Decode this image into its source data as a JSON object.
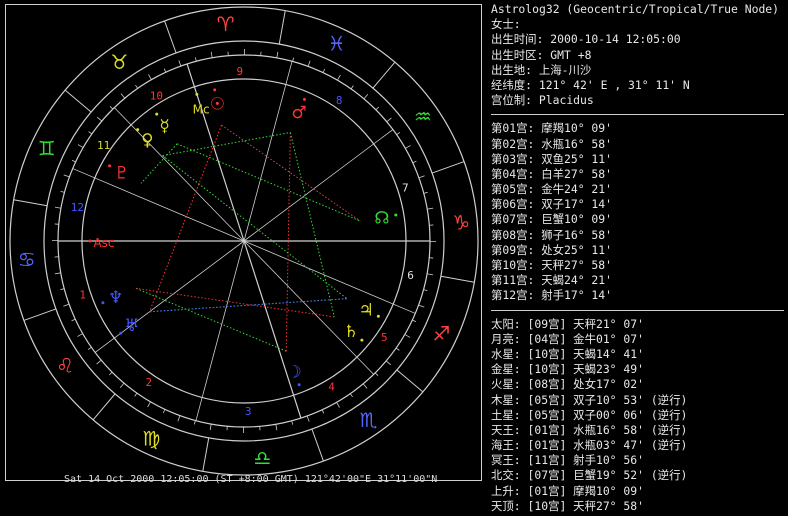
{
  "header": {
    "title": "Astrolog32 (Geocentric/Tropical/True Node)",
    "name_label": "女士:",
    "birth_time": "出生时间: 2000-10-14 12:05:00",
    "birth_zone": "出生时区: GMT +8",
    "birth_place": "出生地: 上海-川沙",
    "coordinates": "经纬度: 121° 42' E , 31° 11' N",
    "house_system": "宫位制: Placidus"
  },
  "houses": [
    "第01宫: 摩羯10° 09'",
    "第02宫: 水瓶16° 58'",
    "第03宫: 双鱼25° 11'",
    "第04宫: 白羊27° 58'",
    "第05宫: 金牛24° 21'",
    "第06宫: 双子17° 14'",
    "第07宫: 巨蟹10° 09'",
    "第08宫: 狮子16° 58'",
    "第09宫: 处女25° 11'",
    "第10宫: 天秤27° 58'",
    "第11宫: 天蝎24° 21'",
    "第12宫: 射手17° 14'"
  ],
  "planets": [
    "太阳: [09宫] 天秤21° 07'",
    "月亮: [04宫] 金牛01° 07'",
    "水星: [10宫] 天蝎14° 41'",
    "金星: [10宫] 天蝎23° 49'",
    "火星: [08宫] 处女17° 02'",
    "木星: [05宫] 双子10° 53' (逆行)",
    "土星: [05宫] 双子00° 06' (逆行)",
    "天王: [01宫] 水瓶16° 58' (逆行)",
    "海王: [01宫] 水瓶03° 47' (逆行)",
    "冥王: [11宫] 射手10° 56'",
    "北交: [07宫] 巨蟹19° 52' (逆行)",
    "上升: [01宫] 摩羯10° 09'",
    "天顶: [10宫] 天秤27° 58'"
  ],
  "chart": {
    "footer": "Sat 14 Oct 2000 12:05:00 (ST +8:00 GMT) 121°42'00\"E 31°11'00\"N",
    "zodiac_signs": [
      {
        "glyph": "♑",
        "name": "capricorn",
        "color": "#ff4444"
      },
      {
        "glyph": "♒",
        "name": "aquarius",
        "color": "#33dd33"
      },
      {
        "glyph": "♓",
        "name": "pisces",
        "color": "#5566ff"
      },
      {
        "glyph": "♈",
        "name": "aries",
        "color": "#ff4444"
      },
      {
        "glyph": "♉",
        "name": "taurus",
        "color": "#dddd22"
      },
      {
        "glyph": "♊",
        "name": "gemini",
        "color": "#33dd33"
      },
      {
        "glyph": "♋",
        "name": "cancer",
        "color": "#5566ff"
      },
      {
        "glyph": "♌",
        "name": "leo",
        "color": "#ff4444"
      },
      {
        "glyph": "♍",
        "name": "virgo",
        "color": "#dddd22"
      },
      {
        "glyph": "♎",
        "name": "libra",
        "color": "#33dd33"
      },
      {
        "glyph": "♏",
        "name": "scorpio",
        "color": "#5566ff"
      },
      {
        "glyph": "♐",
        "name": "sagittarius",
        "color": "#ff4444"
      }
    ],
    "house_numbers": [
      "1",
      "2",
      "3",
      "4",
      "5",
      "6",
      "7",
      "8",
      "9",
      "10",
      "11",
      "12"
    ],
    "planets": [
      {
        "key": "sun",
        "glyph": "☉",
        "lon": 201.12,
        "color": "#ff3333"
      },
      {
        "key": "moon",
        "glyph": "☽",
        "lon": 31.12,
        "color": "#4455ff"
      },
      {
        "key": "mercury",
        "glyph": "☿",
        "lon": 224.68,
        "color": "#dddd22"
      },
      {
        "key": "venus",
        "glyph": "♀",
        "lon": 233.82,
        "color": "#dddd22"
      },
      {
        "key": "mars",
        "glyph": "♂",
        "lon": 167.03,
        "color": "#ff3333"
      },
      {
        "key": "jupiter",
        "glyph": "♃",
        "lon": 70.88,
        "color": "#dddd22"
      },
      {
        "key": "saturn",
        "glyph": "♄",
        "lon": 60.1,
        "color": "#dddd22"
      },
      {
        "key": "uranus",
        "glyph": "♅",
        "lon": 316.97,
        "color": "#4455ff"
      },
      {
        "key": "neptune",
        "glyph": "♆",
        "lon": 303.78,
        "color": "#4455ff"
      },
      {
        "key": "pluto",
        "glyph": "♇",
        "lon": 250.93,
        "color": "#ff3333"
      },
      {
        "key": "node",
        "glyph": "☊",
        "lon": 109.87,
        "color": "#33dd33"
      },
      {
        "key": "asc",
        "glyph": "Asc",
        "lon": 280.15,
        "color": "#ff3333"
      },
      {
        "key": "mc",
        "glyph": "Mc",
        "lon": 207.97,
        "color": "#dddd22"
      }
    ],
    "colors": {
      "frame": "#cfcfcf",
      "red": "#ff3333",
      "green": "#33dd33",
      "blue": "#4455ff",
      "yellow": "#dddd22",
      "white": "#e0e0e0"
    }
  }
}
